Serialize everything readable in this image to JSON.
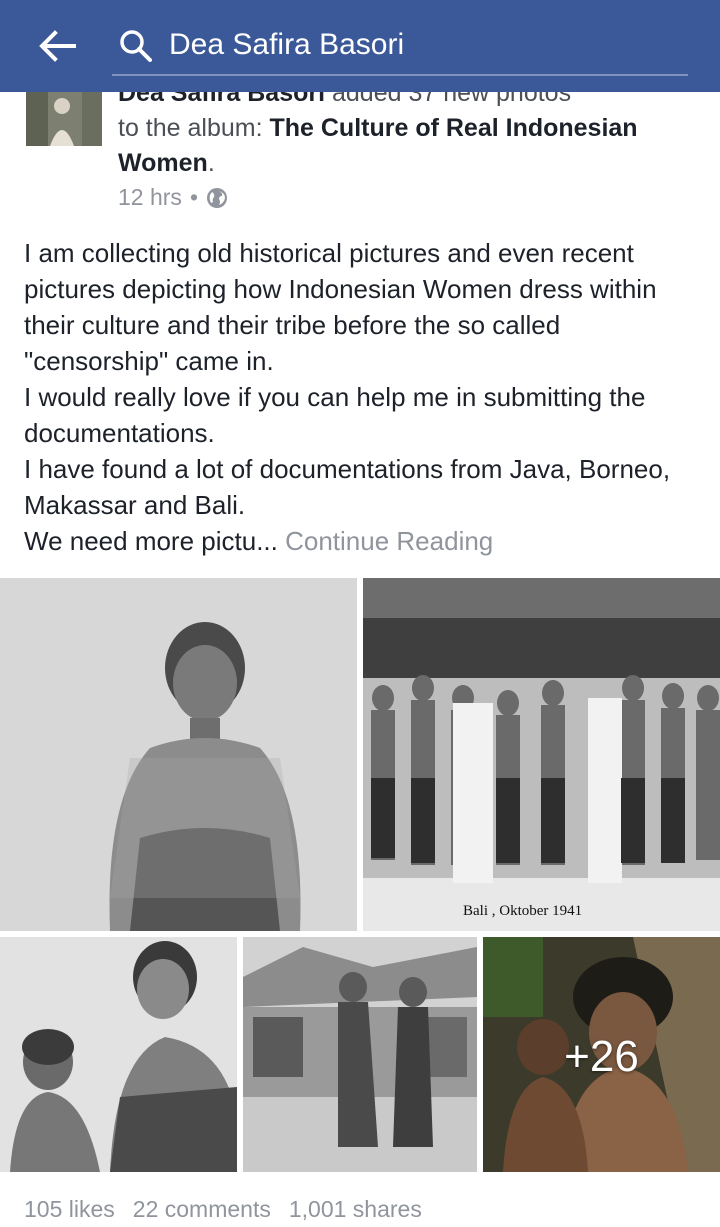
{
  "header": {
    "search_text": "Dea Safira Basori",
    "back_icon": "back-arrow-icon",
    "search_icon": "search-icon",
    "bg_color": "#3b5998"
  },
  "post": {
    "author": "Dea Safira Basori",
    "action": "added 37 new photos",
    "to_album_prefix": "to the album:",
    "album": "The Culture of Real Indonesian Women",
    "period": ".",
    "time": "12 hrs",
    "separator": "•",
    "privacy_icon": "globe-icon",
    "body_lines": [
      "I am collecting old historical pictures and even recent pictures depicting how Indonesian Women dress within their culture and their tribe before the so called \"censorship\" came in.",
      "I would really love if you can help me in submitting the documentations.",
      "I have found a lot of documentations from Java, Borneo, Makassar and Bali."
    ],
    "truncated_line": "We need more pictu...",
    "continue_label": "Continue Reading"
  },
  "photos": {
    "caption_2": "Bali , Oktober 1941",
    "more_count": "+26"
  },
  "stats": {
    "likes": "105 likes",
    "comments": "22 comments",
    "shares": "1,001 shares"
  }
}
